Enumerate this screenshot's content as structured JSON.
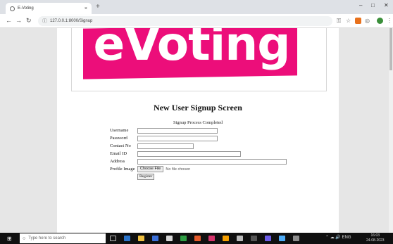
{
  "browser": {
    "tab_title": "E-Voting",
    "tab_close": "×",
    "new_tab": "+",
    "url": "127.0.0.1:8000/Signup",
    "window_controls": [
      "–",
      "□",
      "✕"
    ]
  },
  "banner": {
    "logo_text": "eVoting",
    "logo_color": "#ec0e7a"
  },
  "page": {
    "heading": "New User Signup Screen",
    "status_message": "Signup Process Completed"
  },
  "form": {
    "username_label": "Username",
    "password_label": "Password",
    "contact_label": "Contact No",
    "email_label": "Email ID",
    "address_label": "Address",
    "profile_label": "Profile Image",
    "choose_file": "Choose File",
    "no_file": "No file chosen",
    "register": "Register"
  },
  "taskbar": {
    "search_placeholder": "Type here to search",
    "time": "16:03",
    "date": "24-08-2023"
  }
}
